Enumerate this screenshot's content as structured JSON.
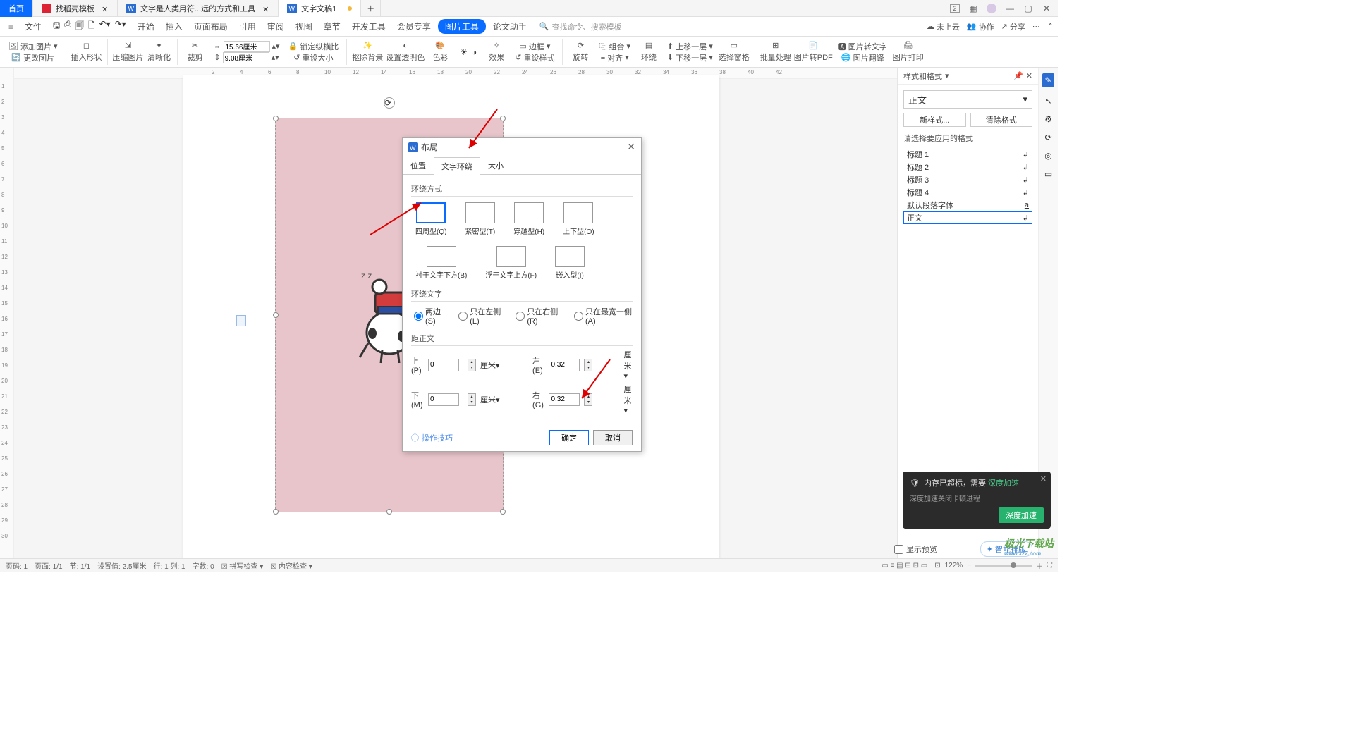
{
  "tabs": {
    "home": "首页",
    "t1": "找稻壳模板",
    "t2": "文字是人类用符...远的方式和工具",
    "t3": "文字文稿1"
  },
  "titlebar_icons": {
    "badge": "2"
  },
  "menubar": {
    "file": "文件",
    "items": [
      "开始",
      "插入",
      "页面布局",
      "引用",
      "审阅",
      "视图",
      "章节",
      "开发工具",
      "会员专享",
      "图片工具",
      "论文助手"
    ],
    "active": "图片工具",
    "search_placeholder": "查找命令、搜索模板",
    "cloud": "未上云",
    "coop": "协作",
    "share": "分享"
  },
  "ribbon": {
    "add_image": "添加图片",
    "change_image": "更改图片",
    "insert_shape": "插入形状",
    "compress": "压缩图片",
    "sharpen": "清晰化",
    "crop": "裁剪",
    "size_w": "15.66厘米",
    "size_h": "9.08厘米",
    "lock_ratio": "锁定纵横比",
    "reset_size": "重设大小",
    "remove_bg": "抠除背景",
    "set_alpha": "设置透明色",
    "color": "色彩",
    "effect": "效果",
    "border": "边框",
    "reset_style": "重设样式",
    "rotate": "旋转",
    "combine": "组合",
    "align": "对齐",
    "wrap": "环绕",
    "move_up": "上移一层",
    "move_down": "下移一层",
    "select_pane": "选择窗格",
    "batch": "批量处理",
    "to_pdf": "图片转PDF",
    "to_text": "图片转文字",
    "translate": "图片翻译",
    "print": "图片打印"
  },
  "right_panel": {
    "title": "样式和格式",
    "current": "正文",
    "new_style": "新样式...",
    "clear": "清除格式",
    "prompt": "请选择要应用的格式",
    "list": [
      "标题 1",
      "标题 2",
      "标题 3",
      "标题 4",
      "默认段落字体",
      "正文"
    ],
    "show_preview": "显示预览",
    "smart_layout": "智能排版"
  },
  "dialog": {
    "title": "布局",
    "tabs": [
      "位置",
      "文字环绕",
      "大小"
    ],
    "section_wrap": "环绕方式",
    "wraps": [
      "四周型(Q)",
      "紧密型(T)",
      "穿越型(H)",
      "上下型(O)",
      "衬于文字下方(B)",
      "浮于文字上方(F)",
      "嵌入型(I)"
    ],
    "section_text": "环绕文字",
    "radios": [
      "两边(S)",
      "只在左侧(L)",
      "只在右侧(R)",
      "只在最宽一侧(A)"
    ],
    "section_dist": "距正文",
    "top": "上(P)",
    "bottom": "下(M)",
    "left": "左(E)",
    "right": "右(G)",
    "unit": "厘米",
    "v_top": "0",
    "v_bottom": "0",
    "v_left": "0.32",
    "v_right": "0.32",
    "hint": "操作技巧",
    "ok": "确定",
    "cancel": "取消"
  },
  "toast": {
    "title_a": "内存已超标，需要",
    "title_b": "深度加速",
    "sub": "深度加速关闭卡顿进程",
    "btn": "深度加速"
  },
  "status": {
    "page_no": "页码: 1",
    "page_cnt": "页面: 1/1",
    "section": "节: 1/1",
    "pos": "设置值: 2.5厘米",
    "rowcol": "行: 1  列: 1",
    "words": "字数: 0",
    "spell": "拼写检查",
    "content": "内容检查",
    "zoom": "122%"
  },
  "watermark": {
    "a": "极光下载站",
    "b": "www.xz7.com"
  }
}
